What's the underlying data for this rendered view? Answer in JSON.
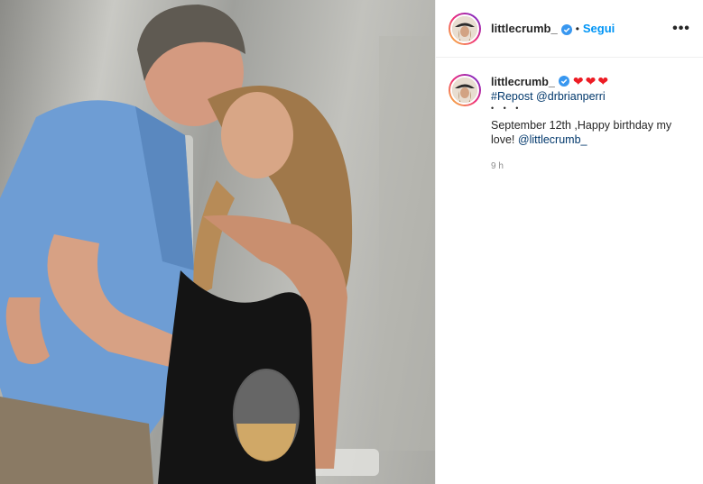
{
  "post": {
    "author": "littlecrumb_",
    "follow_label": "Segui",
    "separator": "•",
    "more_label": "•••",
    "caption": {
      "user": "littlecrumb_",
      "hearts": "❤❤❤",
      "repost_tag": "#Repost",
      "repost_user": "@drbrianperri",
      "bullets": "• • •",
      "text": "September 12th ,Happy birthday my love!",
      "mention": "@littlecrumb_"
    },
    "timestamp": "9 h"
  },
  "icons": {
    "verified": "verified-badge-icon",
    "more": "more-options-icon",
    "hearts": "heart-icon"
  },
  "colors": {
    "link": "#00376b",
    "follow": "#0095f6",
    "verified": "#3897f0",
    "hearts": "#ed1c24",
    "story_ring": "#ee2a7b"
  }
}
